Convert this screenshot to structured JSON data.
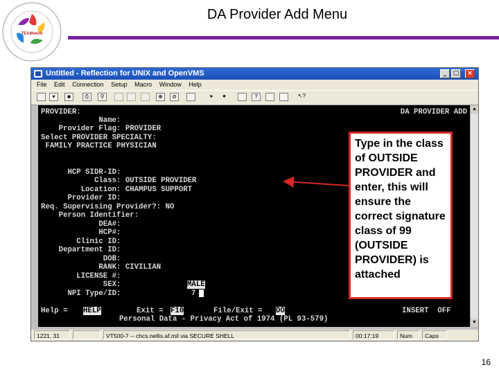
{
  "slide": {
    "title": "DA Provider Add Menu",
    "page_number": "16",
    "rule_color": "#7b1fa2"
  },
  "window": {
    "title": "Untitled - Reflection for UNIX and OpenVMS",
    "minimize": "_",
    "maximize": "□",
    "close": "×",
    "menu": [
      "File",
      "Edit",
      "Connection",
      "Setup",
      "Macro",
      "Window",
      "Help"
    ]
  },
  "terminal": {
    "header_left": "PROVIDER:",
    "header_right": "DA PROVIDER ADD",
    "lines": [
      "             Name:",
      "    Provider Flag: PROVIDER",
      "Select PROVIDER SPECIALTY:",
      " FAMILY PRACTICE PHYSICIAN",
      "",
      "",
      "      HCP SIDR-ID:",
      "            Class: OUTSIDE PROVIDER",
      "         Location: CHAMPUS SUPPORT",
      "      Provider ID:",
      "Req. Supervising Provider?: NO",
      "    Person Identifier:",
      "             DEA#:",
      "             HCP#:",
      "        Clinic ID:",
      "    Department ID:",
      "              DOB:",
      "             RANK: CIVILIAN",
      "        LICENSE #:",
      "              SEX:",
      "      NPI Type/ID:"
    ],
    "sex_value": "MALE",
    "npi_value": "7",
    "footer": {
      "help_label": "Help =",
      "help_key": "HELP",
      "exit_label": "Exit =",
      "exit_key": "F10",
      "fileexit_label": "File/Exit =",
      "fileexit_key": "DO",
      "insert_label": "INSERT  OFF",
      "privacy": "Personal Data - Privacy Act of 1974 (PL 93-579)"
    }
  },
  "status_bar": {
    "position": "1221, 31",
    "connection": "VT500-7 -- chcs.nellis.af.mil via SECURE SHELL",
    "timer": "00:17:19",
    "num": "Num",
    "caps": "Caps"
  },
  "callout": {
    "text": "Type in the class of OUTSIDE PROVIDER and enter, this will ensure the correct signature class of 99 (OUTSIDE PROVIDER) is attached",
    "border_color": "#d62828"
  },
  "logo": {
    "icon": "hands-circle-logo",
    "text": "2011 MHS Revenue Cycle Education Conference"
  }
}
